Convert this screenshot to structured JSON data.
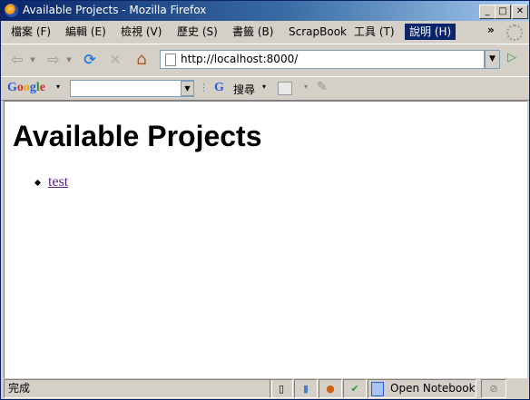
{
  "window": {
    "title": "Available Projects - Mozilla Firefox"
  },
  "titlebar_buttons": {
    "minimize": "_",
    "maximize": "□",
    "close": "✕"
  },
  "menubar": {
    "items": [
      {
        "label": "檔案 (F)"
      },
      {
        "label": "編輯 (E)"
      },
      {
        "label": "檢視 (V)"
      },
      {
        "label": "歷史 (S)"
      },
      {
        "label": "書籤 (B)"
      },
      {
        "label": "ScrapBook"
      },
      {
        "label": "工具 (T)"
      },
      {
        "label": "說明 (H)"
      }
    ],
    "more": "»"
  },
  "navbar": {
    "url": "http://localhost:8000/",
    "back_icon": "⇦",
    "forward_icon": "⇨",
    "reload_icon": "⟳",
    "stop_icon": "✕",
    "home_icon": "⌂",
    "go_icon": "▷",
    "dropdown": "▼"
  },
  "google_toolbar": {
    "logo": {
      "G": "G",
      "o1": "o",
      "o2": "o",
      "g": "g",
      "l": "l",
      "e": "e"
    },
    "search_value": "",
    "search_button": "搜尋",
    "g_icon": "G",
    "arrow": "▾"
  },
  "content": {
    "heading": "Available Projects",
    "projects": [
      {
        "name": "test"
      }
    ]
  },
  "statusbar": {
    "text": "完成",
    "notebook_label": "Open Notebook"
  },
  "colors": {
    "titlebar_start": "#0a246a",
    "titlebar_end": "#a6caf0",
    "link_visited": "#551a8b"
  }
}
